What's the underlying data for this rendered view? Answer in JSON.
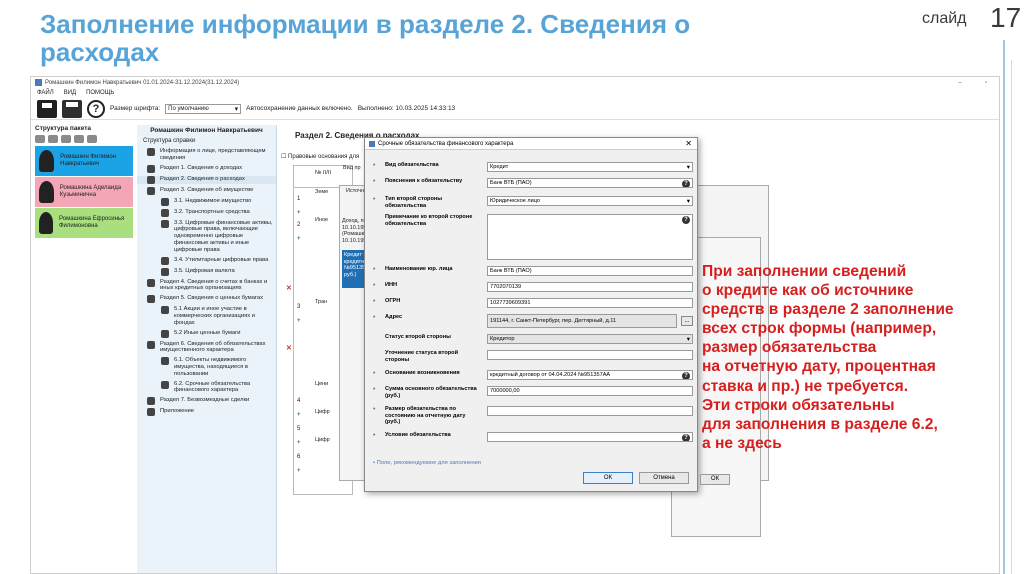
{
  "slide": {
    "title": "Заполнение информации в разделе 2. Сведения о расходах",
    "slide_word": "слайд",
    "slide_number": "17"
  },
  "app": {
    "window_title": "Ромашкин Филимон Навкратьевич 01.01.2024-31.12.2024(31.12.2024)",
    "menu": [
      "ФАЙЛ",
      "ВИД",
      "ПОМОЩЬ"
    ],
    "toolbar": {
      "font_size_label": "Размер шрифта:",
      "font_size_value": "По умолчанию",
      "autosave": "Автосохранение данных включено.",
      "done": "Выполнено: 10.03.2025 14:33:13"
    },
    "package": {
      "title": "Структура пакета",
      "persons": [
        {
          "name": "Ромашкин Филимон Навкратьевич",
          "color": "#1ca3e6"
        },
        {
          "name": "Ромашкина Аделаида Кузьминична",
          "color": "#f3a7b6"
        },
        {
          "name": "Ромашкина Ефросинья Филимоновна",
          "color": "#a9df7e"
        }
      ]
    },
    "tree": {
      "header": "Ромашкин Филимон Навкратьевич",
      "subtitle": "Структура справки",
      "items": [
        {
          "label": "Информация о лице, представляющем сведения",
          "sub": false
        },
        {
          "label": "Раздел 1. Сведения о доходах",
          "sub": false
        },
        {
          "label": "Раздел 2. Сведения о расходах",
          "sub": false,
          "active": true
        },
        {
          "label": "Раздел 3. Сведения об имуществе",
          "sub": false
        },
        {
          "label": "3.1. Недвижимое имущество",
          "sub": true
        },
        {
          "label": "3.2. Транспортные средства",
          "sub": true
        },
        {
          "label": "3.3. Цифровые финансовые активы, цифровые права, включающие одновременно цифровые финансовые активы и иные цифровые права",
          "sub": true
        },
        {
          "label": "3.4. Утилитарные цифровые права",
          "sub": true
        },
        {
          "label": "3.5. Цифровая валюта",
          "sub": true
        },
        {
          "label": "Раздел 4. Сведения о счетах в банках и иных кредитных организациях",
          "sub": false
        },
        {
          "label": "Раздел 5. Сведения о ценных бумагах",
          "sub": false
        },
        {
          "label": "5.1 Акции и иное участие в коммерческих организациях и фондах",
          "sub": true
        },
        {
          "label": "5.2 Иные ценные бумаги",
          "sub": true
        },
        {
          "label": "Раздел 6. Сведения об обязательствах имущественного характера",
          "sub": false
        },
        {
          "label": "6.1. Объекты недвижимого имущества, находящиеся в пользовании",
          "sub": true
        },
        {
          "label": "6.2. Срочные обязательства финансового характера",
          "sub": true
        },
        {
          "label": "Раздел 7. Безвозмездные сделки",
          "sub": false
        },
        {
          "label": "Приложение",
          "sub": false
        }
      ]
    },
    "main": {
      "section_title": "Раздел 2. Сведения о расходах",
      "legal_label": "Правовые основания для",
      "col_num": "№ п/п",
      "col_kind": "Вид пр",
      "bg_items": {
        "zem": "Земе",
        "inoe": "Иное",
        "trans": "Тран",
        "cen": "Цени",
        "cif1": "Цифр",
        "cif2": "Цифр",
        "source": "Источни",
        "doc": "Доход, пол 10.10.1951 (Ромашкин 10.10.1951",
        "credit": "Кредит Бан кредитный №951357А руб.)"
      },
      "rows": [
        "1",
        "2",
        "3",
        "4",
        "5",
        "6"
      ],
      "ok_bg": "ОК"
    },
    "dialog": {
      "title": "Срочные обязательства финансового характера",
      "fields": [
        {
          "label": "Вид обязательства",
          "value": "Кредит",
          "kind": "dd"
        },
        {
          "label": "Пояснения к обязательству",
          "value": "Банк ВТБ (ПАО)",
          "kind": "q"
        },
        {
          "label": "Тип второй стороны обязательства",
          "value": "Юридическое лицо",
          "kind": "dd"
        },
        {
          "label": "Примечание ко второй стороне обязательства",
          "value": "",
          "kind": "area"
        },
        {
          "label": "Наименование юр. лица",
          "value": "Банк ВТБ (ПАО)",
          "kind": "plain"
        },
        {
          "label": "ИНН",
          "value": "7702070139",
          "kind": "plain"
        },
        {
          "label": "ОГРН",
          "value": "1027739609391",
          "kind": "plain"
        },
        {
          "label": "Адрес",
          "value": "191144, г. Санкт-Петербург, пер. Дегтярный, д.11",
          "kind": "addr"
        },
        {
          "label": "Статус второй стороны",
          "value": "Кредитор",
          "kind": "gray"
        },
        {
          "label": "Уточнение статуса второй стороны",
          "value": "",
          "kind": "plain"
        },
        {
          "label": "Основание возникновения",
          "value": "кредитный договор от 04.04.2024 №951357АА",
          "kind": "q"
        },
        {
          "label": "Сумма основного обязательства (руб.)",
          "value": "7000000,00",
          "kind": "plain"
        },
        {
          "label": "Размер обязательства по состоянию на отчетную дату (руб.)",
          "value": "",
          "kind": "plain"
        },
        {
          "label": "Условие обязательства",
          "value": "",
          "kind": "q"
        }
      ],
      "legend": "Поле, рекомендуемое для заполнения",
      "ok": "ОК",
      "cancel": "Отмена"
    }
  },
  "note": "При заполнении сведений\nо кредите как об источнике\nсредств в разделе 2 заполнение\nвсех строк формы (например,\nразмер обязательства\nна отчетную дату, процентная\nставка и пр.) не требуется.\nЭти строки обязательны\nдля заполнения в разделе 6.2,\nа не здесь"
}
